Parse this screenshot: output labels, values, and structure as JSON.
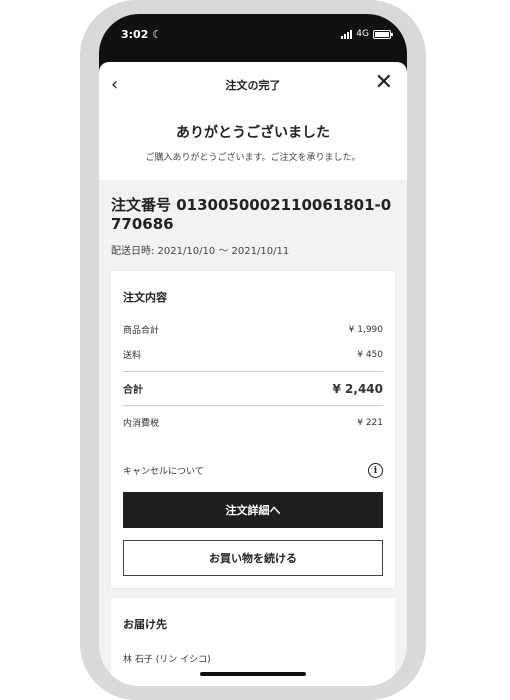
{
  "status": {
    "time": "3:02",
    "moon_icon": "moon-icon",
    "network": "4G"
  },
  "nav": {
    "title": "注文の完了",
    "back_icon": "‹",
    "close_icon": "✕"
  },
  "thanks": {
    "title": "ありがとうございました",
    "subtitle": "ご購入ありがとうございます。ご注文を承りました。"
  },
  "order": {
    "number": "注文番号 0130050002110061801-0770686",
    "ship_date": "配送日時: 2021/10/10 〜 2021/10/11"
  },
  "summary": {
    "title": "注文内容",
    "subtotal_label": "商品合計",
    "subtotal_value": "¥ 1,990",
    "shipping_label": "送料",
    "shipping_value": "¥ 450",
    "total_label": "合計",
    "total_value": "¥ 2,440",
    "tax_label": "内消費税",
    "tax_value": "¥ 221",
    "cancel_label": "キャンセルについて",
    "info_icon": "i",
    "detail_button": "注文詳細へ",
    "continue_button": "お買い物を続ける"
  },
  "delivery": {
    "title": "お届け先",
    "recipient": "林 石子 (リン イシコ)"
  }
}
